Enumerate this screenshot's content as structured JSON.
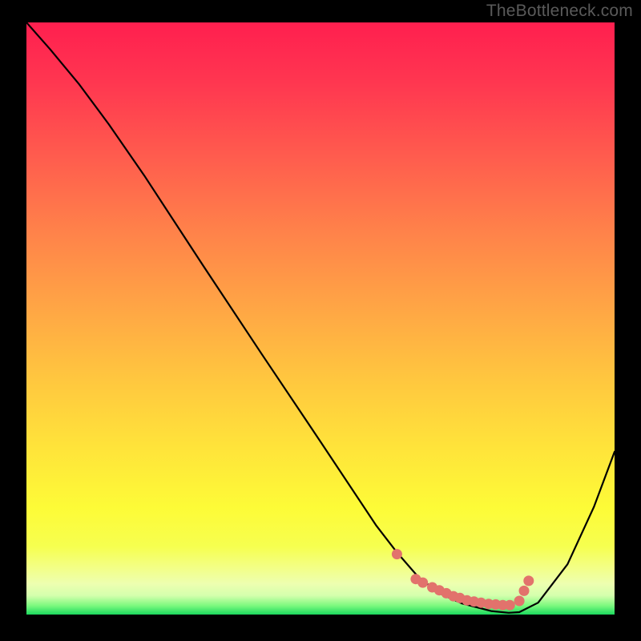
{
  "watermark": {
    "text": "TheBottleneck.com"
  },
  "gradient": {
    "stops": [
      {
        "offset": 0.0,
        "color": "#ff1f4f"
      },
      {
        "offset": 0.1,
        "color": "#ff3650"
      },
      {
        "offset": 0.22,
        "color": "#ff5a4e"
      },
      {
        "offset": 0.35,
        "color": "#ff814a"
      },
      {
        "offset": 0.48,
        "color": "#ffa545"
      },
      {
        "offset": 0.6,
        "color": "#ffc63f"
      },
      {
        "offset": 0.72,
        "color": "#ffe43a"
      },
      {
        "offset": 0.82,
        "color": "#fdfb37"
      },
      {
        "offset": 0.885,
        "color": "#f6ff4f"
      },
      {
        "offset": 0.92,
        "color": "#f3ff85"
      },
      {
        "offset": 0.948,
        "color": "#edffb0"
      },
      {
        "offset": 0.968,
        "color": "#d4ffad"
      },
      {
        "offset": 0.985,
        "color": "#7cf97e"
      },
      {
        "offset": 1.0,
        "color": "#1bd95e"
      }
    ]
  },
  "chart_data": {
    "type": "line",
    "title": "",
    "xlabel": "",
    "ylabel": "",
    "xlim": [
      0,
      1
    ],
    "ylim": [
      0,
      1
    ],
    "grid": false,
    "series": [
      {
        "name": "curve",
        "x": [
          0.0,
          0.04,
          0.09,
          0.14,
          0.2,
          0.3,
          0.4,
          0.5,
          0.595,
          0.63,
          0.665,
          0.7,
          0.74,
          0.79,
          0.82,
          0.838,
          0.87,
          0.92,
          0.965,
          1.0
        ],
        "y": [
          1.0,
          0.955,
          0.895,
          0.828,
          0.742,
          0.59,
          0.44,
          0.292,
          0.15,
          0.105,
          0.065,
          0.037,
          0.019,
          0.006,
          0.003,
          0.004,
          0.02,
          0.085,
          0.182,
          0.275
        ]
      }
    ],
    "markers": {
      "r": 6.5,
      "color": "#e2726c",
      "points_xy": [
        [
          0.63,
          0.102
        ],
        [
          0.662,
          0.06
        ],
        [
          0.674,
          0.054
        ],
        [
          0.69,
          0.046
        ],
        [
          0.702,
          0.041
        ],
        [
          0.714,
          0.036
        ],
        [
          0.726,
          0.031
        ],
        [
          0.737,
          0.028
        ],
        [
          0.749,
          0.024
        ],
        [
          0.761,
          0.022
        ],
        [
          0.773,
          0.02
        ],
        [
          0.786,
          0.018
        ],
        [
          0.798,
          0.017
        ],
        [
          0.81,
          0.016
        ],
        [
          0.822,
          0.016
        ],
        [
          0.838,
          0.023
        ],
        [
          0.846,
          0.04
        ],
        [
          0.854,
          0.057
        ]
      ]
    }
  }
}
